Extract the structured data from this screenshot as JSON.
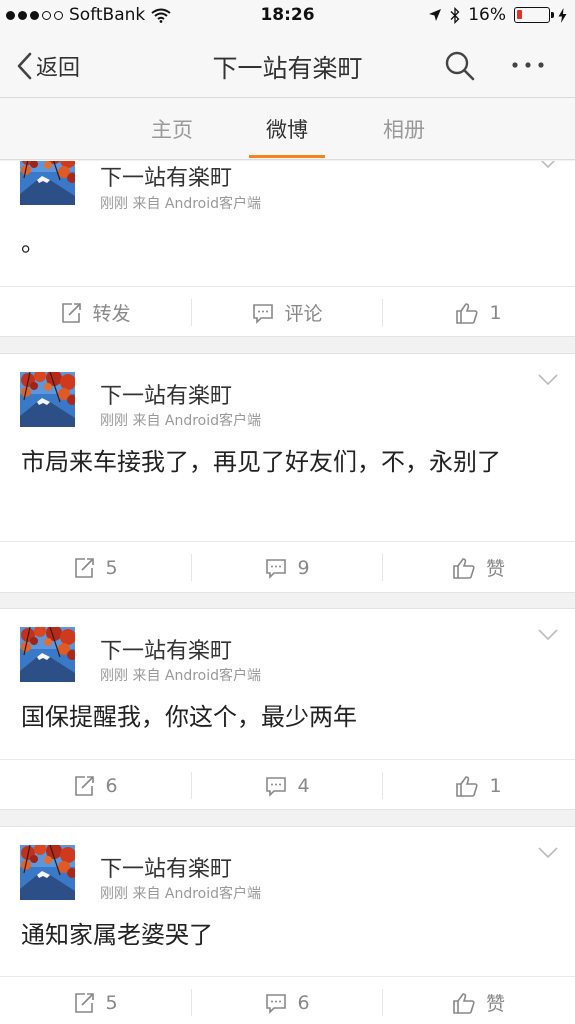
{
  "status_bar": {
    "carrier": "SoftBank",
    "time": "18:26",
    "battery": "16%",
    "battery_level": 0.16
  },
  "nav": {
    "back_label": "返回",
    "title": "下一站有楽町"
  },
  "tabs": [
    {
      "label": "主页",
      "active": false
    },
    {
      "label": "微博",
      "active": true
    },
    {
      "label": "相册",
      "active": false
    }
  ],
  "posts": [
    {
      "author": "下一站有楽町",
      "meta": "刚刚  来自 Android客户端",
      "text": "。",
      "repost": "转发",
      "comment": "评论",
      "like": "1"
    },
    {
      "author": "下一站有楽町",
      "meta": "刚刚  来自 Android客户端",
      "text": "市局来车接我了，再见了好友们，不，永别了",
      "repost": "5",
      "comment": "9",
      "like": "赞"
    },
    {
      "author": "下一站有楽町",
      "meta": "刚刚  来自 Android客户端",
      "text": "国保提醒我，你这个，最少两年",
      "repost": "6",
      "comment": "4",
      "like": "1"
    },
    {
      "author": "下一站有楽町",
      "meta": "刚刚  来自 Android客户端",
      "text": "通知家属老婆哭了",
      "repost": "5",
      "comment": "6",
      "like": "赞"
    }
  ],
  "icons": {
    "back": "chevron-left-icon",
    "search": "search-icon",
    "more": "more-icon",
    "repost": "repost-icon",
    "comment": "comment-icon",
    "like": "thumbs-up-icon"
  },
  "colors": {
    "accent": "#f5841f",
    "battery_low": "#e0332a"
  }
}
